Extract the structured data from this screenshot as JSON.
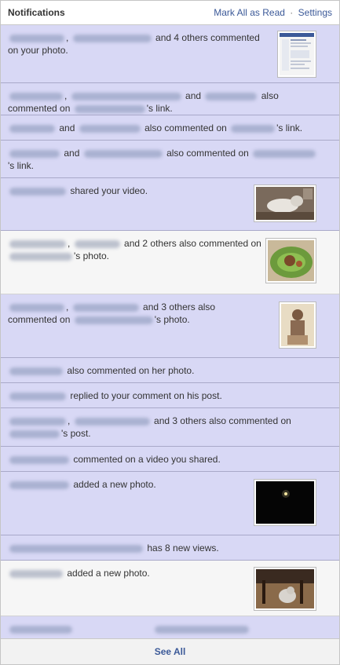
{
  "header": {
    "title": "Notifications",
    "mark_all_read": "Mark All as Read",
    "separator": "·",
    "settings": "Settings"
  },
  "notifications": [
    {
      "text_1": ",",
      "text_2": "and 4 others commented on your photo."
    },
    {
      "text_1": ",",
      "text_2": "and",
      "text_3": "also commented on",
      "text_4": "'s link."
    },
    {
      "text_1": "and",
      "text_2": "also commented on",
      "text_3": "'s link."
    },
    {
      "text_1": "and",
      "text_2": "also commented on",
      "text_3": "'s link."
    },
    {
      "text_1": "shared your video."
    },
    {
      "text_1": ",",
      "text_2": "and 2 others also commented on",
      "text_3": "'s photo."
    },
    {
      "text_1": ",",
      "text_2": "and 3 others also commented on",
      "text_3": "'s photo."
    },
    {
      "text_1": "also commented on her photo."
    },
    {
      "text_1": "replied to your comment on his post."
    },
    {
      "text_1": ",",
      "text_2": "and 3 others also commented on",
      "text_3": "'s post."
    },
    {
      "text_1": "commented on a video you shared."
    },
    {
      "text_1": "added a new photo."
    },
    {
      "text_1": "has 8 new views."
    },
    {
      "text_1": "added a new photo."
    }
  ],
  "footer": {
    "see_all": "See All"
  },
  "colors": {
    "unread_bg": "#d8d8f5",
    "read_bg": "#f6f6f6",
    "link": "#3b5998"
  }
}
